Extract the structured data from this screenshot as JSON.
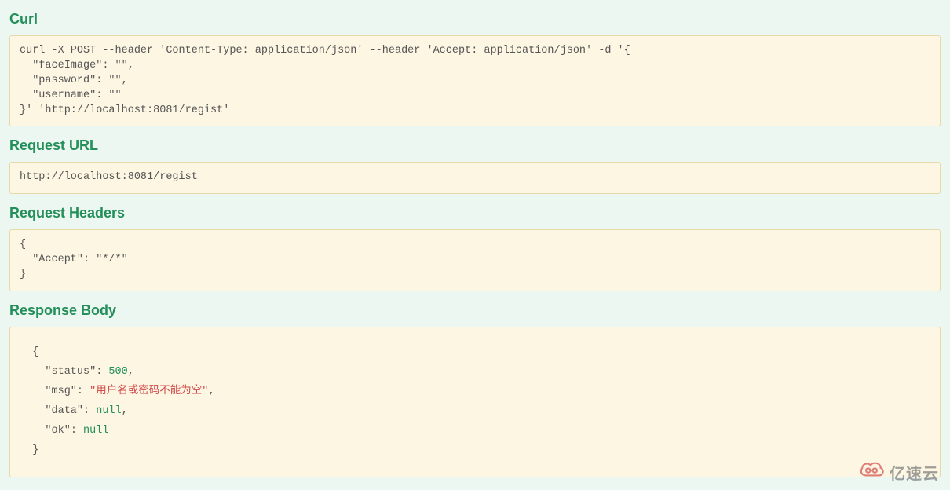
{
  "sections": {
    "curl": {
      "heading": "Curl",
      "content": "curl -X POST --header 'Content-Type: application/json' --header 'Accept: application/json' -d '{\n  \"faceImage\": \"\",\n  \"password\": \"\",\n  \"username\": \"\"\n}' 'http://localhost:8081/regist'"
    },
    "request_url": {
      "heading": "Request URL",
      "content": "http://localhost:8081/regist"
    },
    "request_headers": {
      "heading": "Request Headers",
      "content": "{\n  \"Accept\": \"*/*\"\n}"
    },
    "response_body": {
      "heading": "Response Body",
      "json": {
        "open": "{",
        "lines": [
          {
            "key": "\"status\"",
            "sep": ": ",
            "val": "500",
            "valClass": "json-number",
            "comma": ","
          },
          {
            "key": "\"msg\"",
            "sep": ": ",
            "val": "\"用户名或密码不能为空\"",
            "valClass": "json-string",
            "comma": ","
          },
          {
            "key": "\"data\"",
            "sep": ": ",
            "val": "null",
            "valClass": "json-null",
            "comma": ","
          },
          {
            "key": "\"ok\"",
            "sep": ": ",
            "val": "null",
            "valClass": "json-null",
            "comma": ""
          }
        ],
        "close": "}"
      }
    }
  },
  "watermark": {
    "text": "亿速云"
  }
}
